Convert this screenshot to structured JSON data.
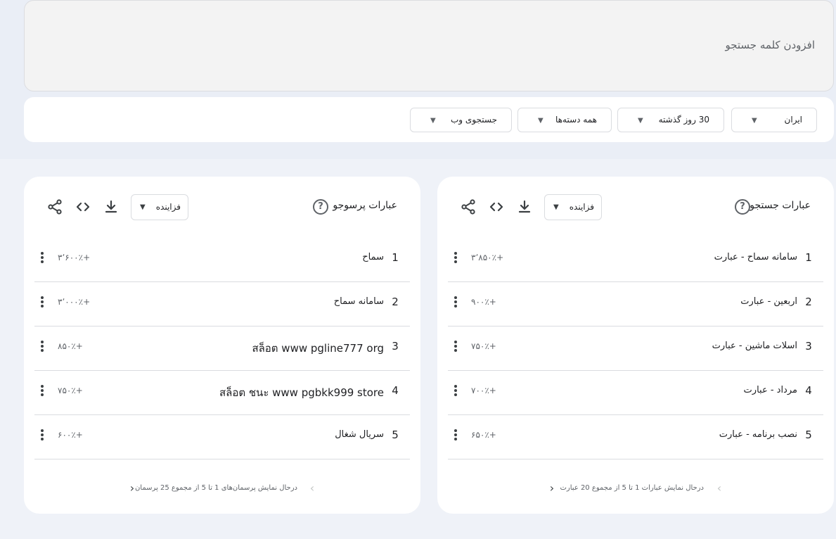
{
  "search": {
    "placeholder": "افزودن کلمه جستجو"
  },
  "filters": {
    "region": "ایران",
    "time": "30 روز گذشته",
    "category": "همه دسته‌ها",
    "property": "جستجوی وب"
  },
  "panels": [
    {
      "title": "عبارات جستجو",
      "sort": "فزاینده",
      "rows": [
        {
          "rank": "1",
          "term": "سامانه سماح - عبارت",
          "value": "۳٬۸۵۰٪+"
        },
        {
          "rank": "2",
          "term": "اربعین - عبارت",
          "value": "۹۰۰٪+"
        },
        {
          "rank": "3",
          "term": "اسلات ماشین - عبارت",
          "value": "۷۵۰٪+"
        },
        {
          "rank": "4",
          "term": "مرداد - عبارت",
          "value": "۷۰۰٪+"
        },
        {
          "rank": "5",
          "term": "نصب برنامه - عبارت",
          "value": "۶۵۰٪+"
        }
      ],
      "pager": "درحال نمایش عبارات 1 تا 5 از مجموع 20 عبارت"
    },
    {
      "title": "عبارات پرسوجو",
      "sort": "فزاینده",
      "rows": [
        {
          "rank": "1",
          "term": "سماح",
          "value": "۳٬۶۰۰٪+"
        },
        {
          "rank": "2",
          "term": "سامانه سماح",
          "value": "۳٬۰۰۰٪+"
        },
        {
          "rank": "3",
          "term": "สล็อต www pgline777 org",
          "value": "۸۵۰٪+"
        },
        {
          "rank": "4",
          "term": "สล็อต ชนะ www pgbkk999 store",
          "value": "۷۵۰٪+"
        },
        {
          "rank": "5",
          "term": "سریال شغال",
          "value": "۶۰۰٪+"
        }
      ],
      "pager": "درحال نمایش پرسمان‌های 1 تا 5 از مجموع 25 پرسمان"
    }
  ],
  "icons": {
    "filter_caret": "caret-down-icon",
    "help": "help-circle-icon",
    "download": "download-icon",
    "embed": "code-icon",
    "share": "share-icon",
    "more": "more-vert-icon",
    "prev": "chevron-left-icon",
    "next": "chevron-right-icon"
  },
  "colors": {
    "page_background": "#eff2f8",
    "card": "#ffffff",
    "text": "#202124",
    "muted": "#5f6368",
    "divider": "#dadce0"
  }
}
